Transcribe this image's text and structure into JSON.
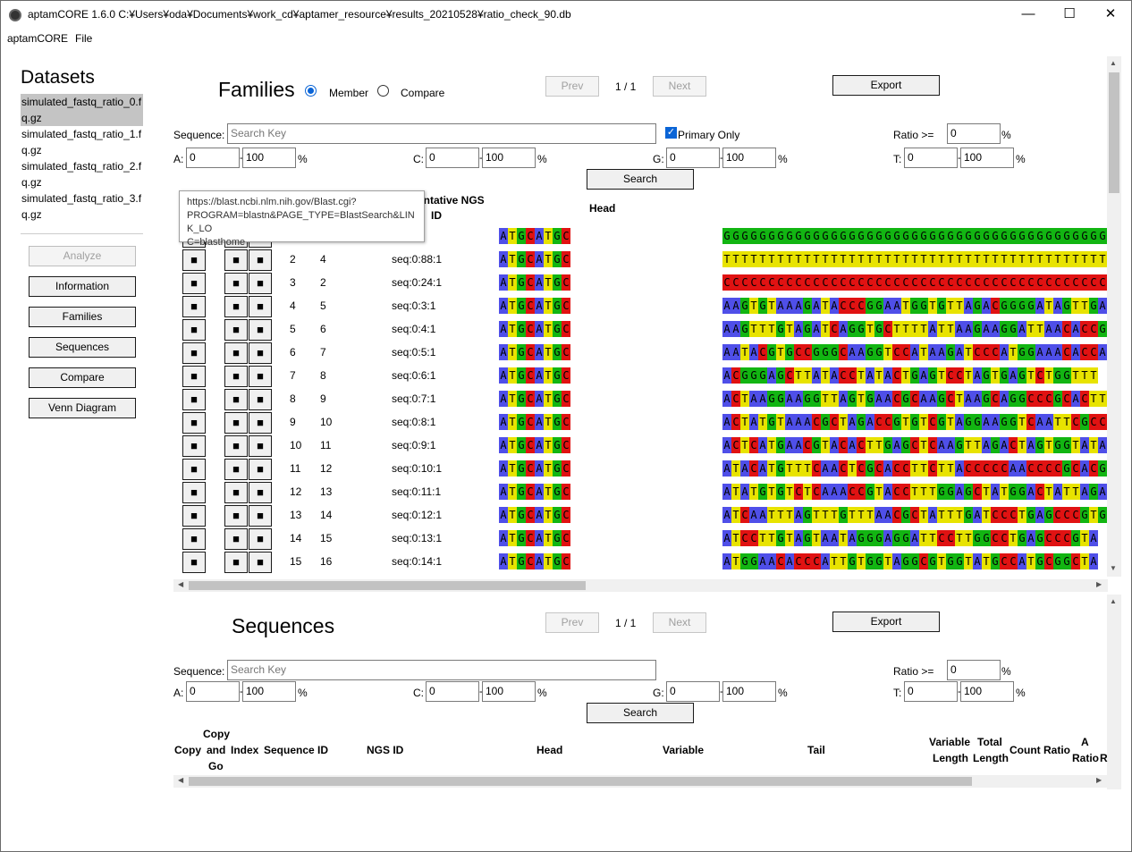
{
  "window": {
    "title": "aptamCORE 1.6.0 C:¥Users¥oda¥Documents¥work_cd¥aptamer_resource¥results_20210528¥ratio_check_90.db",
    "minimize": "—",
    "maximize": "☐",
    "close": "✕"
  },
  "menu": [
    "aptamCORE",
    "File"
  ],
  "sidebar": {
    "title": "Datasets",
    "datasets": [
      {
        "line1": "simulated_fastq_ratio_0.f",
        "line2": "q.gz"
      },
      {
        "line1": "simulated_fastq_ratio_1.f",
        "line2": "q.gz"
      },
      {
        "line1": "simulated_fastq_ratio_2.f",
        "line2": "q.gz"
      },
      {
        "line1": "simulated_fastq_ratio_3.f",
        "line2": "q.gz"
      }
    ],
    "buttons": [
      "Analyze",
      "Information",
      "Families",
      "Sequences",
      "Compare",
      "Venn Diagram"
    ]
  },
  "families": {
    "title": "Families",
    "radio_member": "Member",
    "radio_compare": "Compare",
    "prev": "Prev",
    "page": "1 / 1",
    "next": "Next",
    "export": "Export",
    "sequence_label": "Sequence:",
    "search_placeholder": "Search Key",
    "primary_only": "Primary Only",
    "ratio_label": "Ratio >=",
    "ratio_value": "0",
    "pct": "%",
    "filters": {
      "A": {
        "label": "A:",
        "min": "0",
        "max": "100"
      },
      "C": {
        "label": "C:",
        "min": "0",
        "max": "100"
      },
      "G": {
        "label": "G:",
        "min": "0",
        "max": "100"
      },
      "T": {
        "label": "T:",
        "min": "0",
        "max": "100"
      }
    },
    "search_button": "Search",
    "headers": {
      "rep_ngs_1": "entative NGS",
      "rep_ngs_2": "ID",
      "head": "Head"
    },
    "copy_glyph": "■",
    "head_seq": "ATGCATGC",
    "rows": [
      {
        "a": "",
        "b": "",
        "ngs": "2:1",
        "var": "GGGGGGGGGGGGGGGGGGGGGGGGGGGGGGGGGGGGGGGGGGGGGG"
      },
      {
        "a": "2",
        "b": "4",
        "ngs": "seq:0:88:1",
        "var": "TTTTTTTTTTTTTTTTTTTTTTTTTTTTTTTTTTTTTTTTTTTTTT"
      },
      {
        "a": "3",
        "b": "2",
        "ngs": "seq:0:24:1",
        "var": "CCCCCCCCCCCCCCCCCCCCCCCCCCCCCCCCCCCCCCCCCCCCCC"
      },
      {
        "a": "4",
        "b": "5",
        "ngs": "seq:0:3:1",
        "var": "AAGTGTAAAGATACCCGGAATGGTGTTAGACGGGGATAGTTGA"
      },
      {
        "a": "5",
        "b": "6",
        "ngs": "seq:0:4:1",
        "var": "AAGTTTGTAGATCAGGTGCTTTTATTAAGAAGGATTAACACCG"
      },
      {
        "a": "6",
        "b": "7",
        "ngs": "seq:0:5:1",
        "var": "AATACGTGCCGGGCAAGGTCCATAAGATCCCATGGAAACACCA"
      },
      {
        "a": "7",
        "b": "8",
        "ngs": "seq:0:6:1",
        "var": "ACGGGAGCTTATACCTATACTGAGTCCTAGTGAGTCTGGTTT"
      },
      {
        "a": "8",
        "b": "9",
        "ngs": "seq:0:7:1",
        "var": "ACTAAGGAAGGTTAGTGAACGCAAGCTAAGCAGGCCCGCACTT"
      },
      {
        "a": "9",
        "b": "10",
        "ngs": "seq:0:8:1",
        "var": "ACTATGTAAACGCTAGACCGTGTCGTAGGAAGGTCAATTCGCCT"
      },
      {
        "a": "10",
        "b": "11",
        "ngs": "seq:0:9:1",
        "var": "ACTCATGAACGTACACTTGAGCTCAAGTTAGACTAGTGGTATA"
      },
      {
        "a": "11",
        "b": "12",
        "ngs": "seq:0:10:1",
        "var": "ATACATGTTTCAACTCGCACCTTCTTACCCCCAACCCCGCACG"
      },
      {
        "a": "12",
        "b": "13",
        "ngs": "seq:0:11:1",
        "var": "ATATGTGTCTCAAACCGTACCTTTGGAGCTATGGACTATTAGA"
      },
      {
        "a": "13",
        "b": "14",
        "ngs": "seq:0:12:1",
        "var": "ATCAATTTAGTTTGTTTAACGCTATTTGATCCCTGAGCCCGTG"
      },
      {
        "a": "14",
        "b": "15",
        "ngs": "seq:0:13:1",
        "var": "ATCCTTGTAGTAATAGGGAGGATTCCTTGGCCTGAGCCCGTA"
      },
      {
        "a": "15",
        "b": "16",
        "ngs": "seq:0:14:1",
        "var": "ATGGAACACCCATTGTGGTAGGCGTGGTATGCCATGCGGCTA"
      }
    ]
  },
  "tooltip": {
    "line1": "https://blast.ncbi.nlm.nih.gov/Blast.cgi?",
    "line2": "PROGRAM=blastn&PAGE_TYPE=BlastSearch&LINK_LO",
    "line3": "C=blasthome"
  },
  "sequences": {
    "title": "Sequences",
    "prev": "Prev",
    "page": "1 / 1",
    "next": "Next",
    "export": "Export",
    "sequence_label": "Sequence:",
    "search_placeholder": "Search Key",
    "ratio_label": "Ratio >=",
    "ratio_value": "0",
    "pct": "%",
    "filters": {
      "A": {
        "label": "A:",
        "min": "0",
        "max": "100"
      },
      "C": {
        "label": "C:",
        "min": "0",
        "max": "100"
      },
      "G": {
        "label": "G:",
        "min": "0",
        "max": "100"
      },
      "T": {
        "label": "T:",
        "min": "0",
        "max": "100"
      }
    },
    "search_button": "Search",
    "headers": {
      "copy": "Copy",
      "copy_and_go_1": "Copy",
      "copy_and_go_2": "and",
      "copy_and_go_3": "Go",
      "index": "Index",
      "sequence_id": "Sequence ID",
      "ngs_id": "NGS ID",
      "head": "Head",
      "variable": "Variable",
      "tail": "Tail",
      "variable_length_1": "Variable",
      "variable_length_2": "Length",
      "total_length_1": "Total",
      "total_length_2": "Length",
      "count_ratio": "Count Ratio",
      "a_ratio_1": "A",
      "a_ratio_2": "Ratio",
      "r_cut": "R"
    }
  },
  "colors": {
    "A": "#4f4fe8",
    "T": "#e8e300",
    "G": "#12b512",
    "C": "#e01212",
    "radio_accent": "#0a64d6"
  }
}
